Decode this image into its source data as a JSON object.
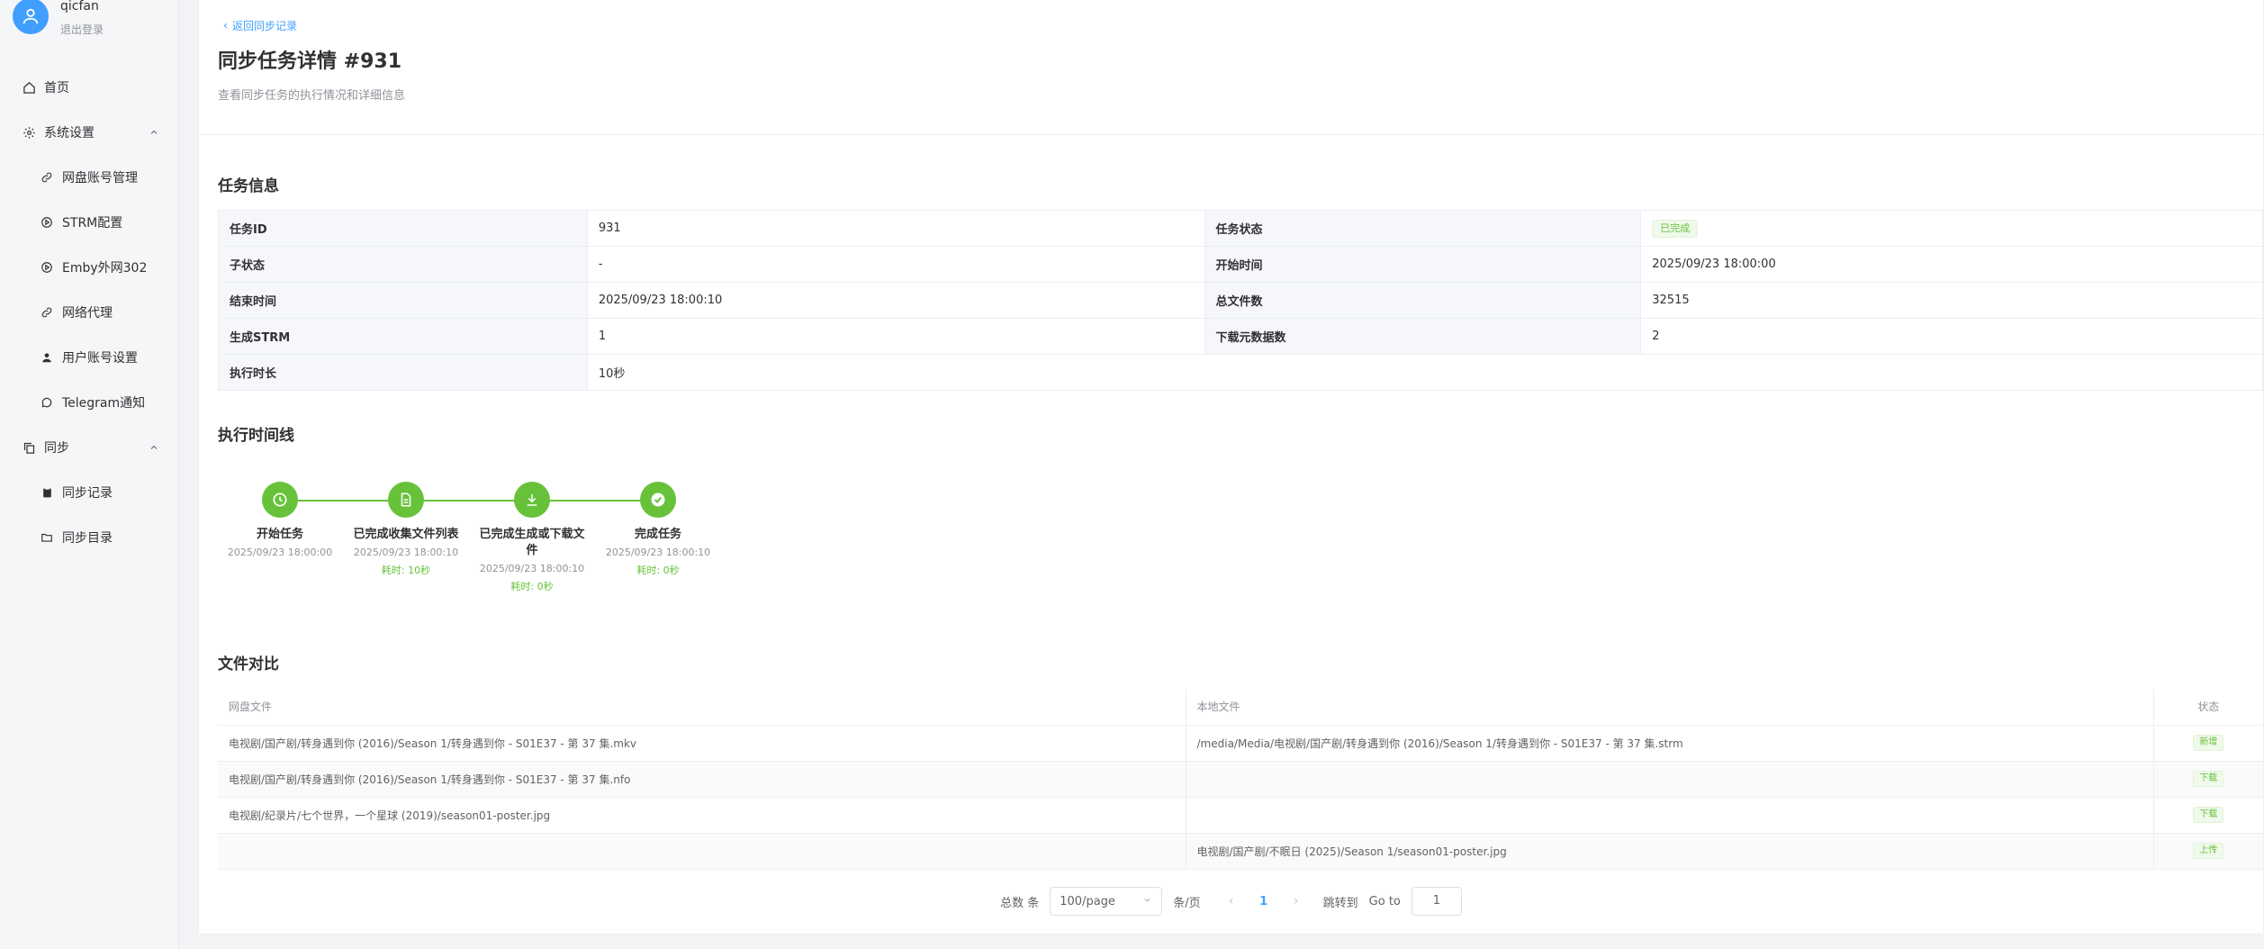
{
  "user": {
    "name": "qicfan",
    "logout": "退出登录"
  },
  "nav": [
    {
      "label": "首页",
      "icon": "home-icon",
      "level": 0
    },
    {
      "label": "系统设置",
      "icon": "gear-icon",
      "level": 0,
      "expand": true
    },
    {
      "label": "网盘账号管理",
      "icon": "link-icon",
      "level": 1
    },
    {
      "label": "STRM配置",
      "icon": "play-circle-icon",
      "level": 1
    },
    {
      "label": "Emby外网302",
      "icon": "play-circle-icon",
      "level": 1
    },
    {
      "label": "网络代理",
      "icon": "link-icon",
      "level": 1
    },
    {
      "label": "用户账号设置",
      "icon": "user-icon",
      "level": 1
    },
    {
      "label": "Telegram通知",
      "icon": "chat-icon",
      "level": 1
    },
    {
      "label": "同步",
      "icon": "copy-icon",
      "level": 0,
      "expand": true
    },
    {
      "label": "同步记录",
      "icon": "clipboard-icon",
      "level": 1
    },
    {
      "label": "同步目录",
      "icon": "folder-icon",
      "level": 1
    }
  ],
  "header": {
    "back": "返回同步记录",
    "title": "同步任务详情 #931",
    "subtitle": "查看同步任务的执行情况和详细信息"
  },
  "info": {
    "title": "任务信息",
    "task_id_label": "任务ID",
    "task_id": "931",
    "status_label": "任务状态",
    "status": "已完成",
    "substatus_label": "子状态",
    "substatus": "-",
    "start_label": "开始时间",
    "start": "2025/09/23 18:00:00",
    "end_label": "结束时间",
    "end": "2025/09/23 18:00:10",
    "total_label": "总文件数",
    "total": "32515",
    "strm_label": "生成STRM",
    "strm": "1",
    "meta_label": "下载元数据数",
    "meta": "2",
    "duration_label": "执行时长",
    "duration": "10秒"
  },
  "timeline": {
    "title": "执行时间线",
    "steps": [
      {
        "name": "开始任务",
        "time": "2025/09/23 18:00:00",
        "cost": "",
        "icon": "clock-icon"
      },
      {
        "name": "已完成收集文件列表",
        "time": "2025/09/23 18:00:10",
        "cost": "耗时: 10秒",
        "icon": "document-icon"
      },
      {
        "name": "已完成生成或下载文件",
        "time": "2025/09/23 18:00:10",
        "cost": "耗时: 0秒",
        "icon": "download-icon"
      },
      {
        "name": "完成任务",
        "time": "2025/09/23 18:00:10",
        "cost": "耗时: 0秒",
        "icon": "check-circle-icon"
      }
    ]
  },
  "files": {
    "title": "文件对比",
    "headers": [
      "网盘文件",
      "本地文件",
      "状态"
    ],
    "rows": [
      {
        "remote": "电视剧/国产剧/转身遇到你 (2016)/Season 1/转身遇到你 - S01E37 - 第 37 集.mkv",
        "local": "/media/Media/电视剧/国产剧/转身遇到你 (2016)/Season 1/转身遇到你 - S01E37 - 第 37 集.strm",
        "status": "新增"
      },
      {
        "remote": "电视剧/国产剧/转身遇到你 (2016)/Season 1/转身遇到你 - S01E37 - 第 37 集.nfo",
        "local": "",
        "status": "下载"
      },
      {
        "remote": "电视剧/纪录片/七个世界，一个星球 (2019)/season01-poster.jpg",
        "local": "",
        "status": "下载"
      },
      {
        "remote": "",
        "local": "电视剧/国产剧/不眠日 (2025)/Season 1/season01-poster.jpg",
        "status": "上传"
      }
    ]
  },
  "pager": {
    "total_label": "总数 条",
    "page_size": "100/page",
    "per_page_label": "条/页",
    "current": "1",
    "goto_label": "跳转到",
    "goto_en": "Go to",
    "goto_value": "1"
  },
  "colors": {
    "accent": "#409eff",
    "success": "#67c23a"
  }
}
